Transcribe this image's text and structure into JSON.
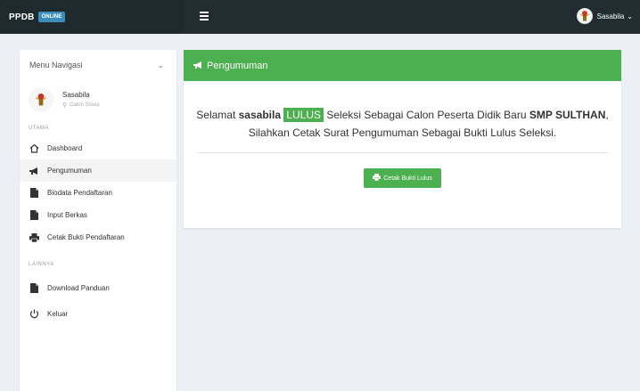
{
  "topbar": {
    "brand": "PPDB",
    "brand_badge": "ONLINE",
    "user_name": "Sasabila",
    "user_caret": "⌄"
  },
  "sidebar": {
    "header_label": "Menu Navigasi",
    "header_caret": "⌄",
    "user": {
      "name": "Sasabila",
      "role": "Calon Siswa"
    },
    "sections": [
      {
        "label": "UTAMA",
        "items": [
          {
            "label": "Dashboard",
            "icon": "home-icon"
          },
          {
            "label": "Pengumuman",
            "icon": "bullhorn-icon",
            "active": true
          },
          {
            "label": "Biodata Pendaftaran",
            "icon": "file-icon"
          },
          {
            "label": "Input Berkas",
            "icon": "file-icon"
          },
          {
            "label": "Cetak Bukti Pendaftaran",
            "icon": "print-icon"
          }
        ]
      },
      {
        "label": "LAINNYA",
        "items": [
          {
            "label": "Download Panduan",
            "icon": "file-icon"
          },
          {
            "label": "Keluar",
            "icon": "power-icon"
          }
        ]
      }
    ]
  },
  "card": {
    "title": "Pengumuman",
    "message": {
      "part1": "Selamat ",
      "name": "sasabila",
      "badge": "LULUS",
      "part2": " Seleksi Sebagai Calon Peserta Didik Baru ",
      "school": "SMP SULTHAN",
      "part3": ", Silahkan Cetak Surat Pengumuman Sebagai Bukti Lulus Seleksi."
    },
    "button_label": "Cetak Bukti Lulus"
  },
  "colors": {
    "accent_green": "#4caf50",
    "topbar": "#222d32",
    "badge_blue": "#3c8dbc",
    "background": "#ecf0f5"
  }
}
